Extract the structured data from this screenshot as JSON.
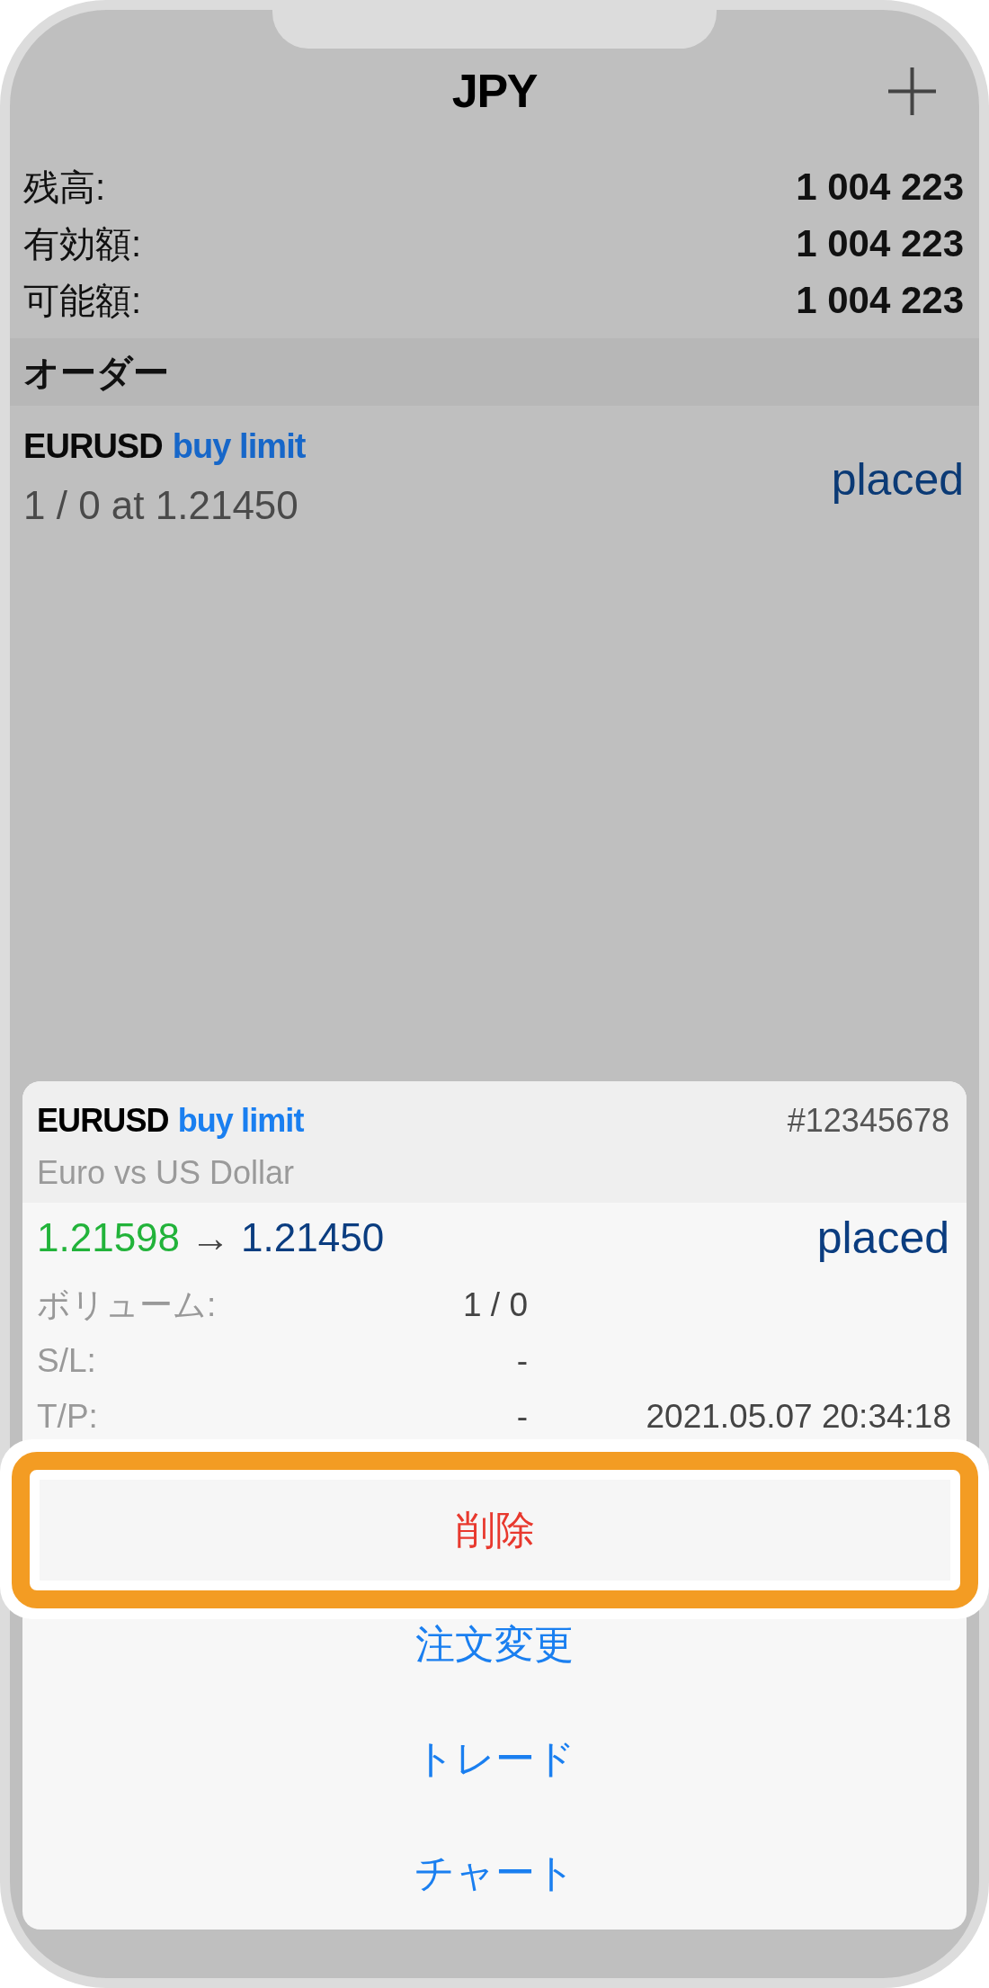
{
  "header": {
    "title": "JPY"
  },
  "account": [
    {
      "label": "残高:",
      "value": "1 004 223"
    },
    {
      "label": "有効額:",
      "value": "1 004 223"
    },
    {
      "label": "可能額:",
      "value": "1 004 223"
    }
  ],
  "section": {
    "title": "オーダー"
  },
  "orders": [
    {
      "symbol": "EURUSD",
      "type": "buy limit",
      "details": "1 / 0 at 1.21450",
      "status": "placed"
    }
  ],
  "order_sheet": {
    "symbol": "EURUSD",
    "type": "buy limit",
    "ticket": "#12345678",
    "description": "Euro vs US Dollar",
    "price_from": "1.21598",
    "arrow": "→",
    "price_to": "1.21450",
    "status": "placed",
    "fields": [
      {
        "label": "ボリューム:",
        "value": "1 / 0"
      },
      {
        "label": "S/L:",
        "value": "-"
      },
      {
        "label": "T/P:",
        "value": "-",
        "time": "2021.05.07 20:34:18"
      }
    ],
    "actions": [
      {
        "label": "削除",
        "kind": "destructive",
        "highlighted": true
      },
      {
        "label": "注文変更",
        "kind": "default",
        "highlighted": false
      },
      {
        "label": "トレード",
        "kind": "default",
        "highlighted": false
      },
      {
        "label": "チャート",
        "kind": "default",
        "highlighted": false
      }
    ]
  }
}
